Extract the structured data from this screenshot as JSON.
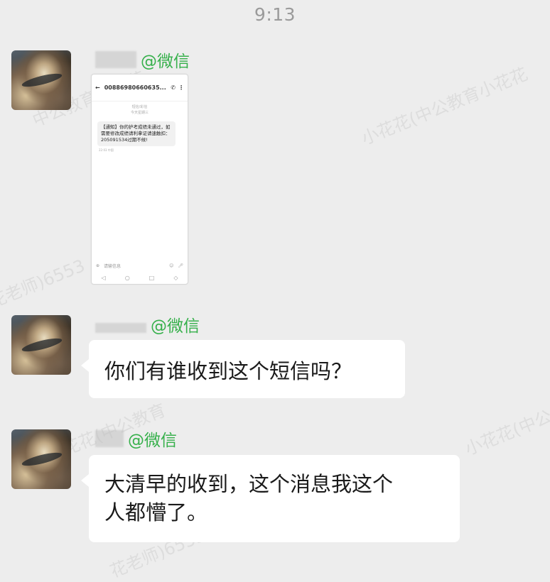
{
  "status_bar": {
    "time": "9:13"
  },
  "watermarks": [
    "中公教育小花花",
    "小花花(中公教育小花花",
    "花老师)6553",
    "小花花(中公教育",
    "小花花(中公",
    "花老师)6553"
  ],
  "messages": [
    {
      "sender_tag": "@微信",
      "type": "image",
      "screenshot": {
        "phone_number": "008869806606​35...",
        "meta_line1": "短信/彩信",
        "meta_line2": "今天星期三",
        "sms_text": "【通知】你的护考成绩未通过，如需要修改成绩请利拿证请速触扣：205091534过期不候!",
        "sms_time": "22:03 中国",
        "input_placeholder": "请输信息"
      }
    },
    {
      "sender_tag": "@微信",
      "type": "text",
      "text": "你们有谁收到这个短信吗？"
    },
    {
      "sender_tag": "@微信",
      "type": "text",
      "text_line1": "大清早的收到，这个消息我这个",
      "text_line2": "人都懵了。"
    }
  ],
  "colors": {
    "background": "#ededed",
    "wechat_green": "#36b04b",
    "bubble": "#ffffff",
    "time": "#9a9a9a"
  }
}
